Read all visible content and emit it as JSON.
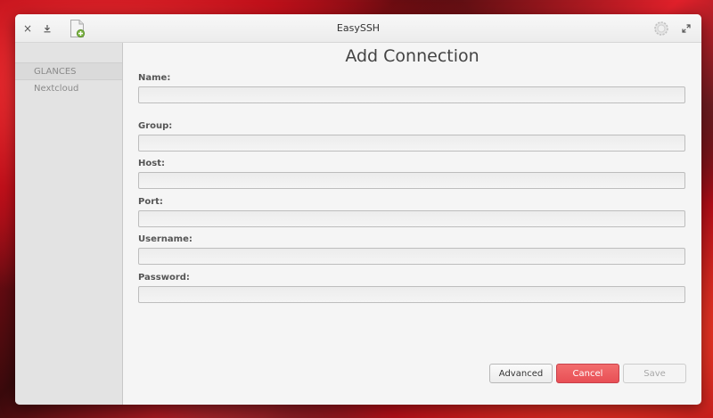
{
  "window": {
    "title": "EasySSH"
  },
  "titlebar": {
    "close_icon": "×"
  },
  "sidebar": {
    "items": [
      {
        "label": "GLANCES",
        "selected": true
      },
      {
        "label": "Nextcloud",
        "selected": false
      }
    ]
  },
  "form": {
    "title": "Add Connection",
    "fields": [
      {
        "label": "Name:",
        "value": ""
      },
      {
        "label": "Group:",
        "value": ""
      },
      {
        "label": "Host:",
        "value": ""
      },
      {
        "label": "Port:",
        "value": ""
      },
      {
        "label": "Username:",
        "value": ""
      },
      {
        "label": "Password:",
        "value": ""
      }
    ]
  },
  "buttons": {
    "advanced": "Advanced",
    "cancel": "Cancel",
    "save": "Save"
  },
  "colors": {
    "cancel_accent": "#e84f55",
    "window_bg": "#f5f5f5",
    "sidebar_bg": "#e3e3e3"
  }
}
